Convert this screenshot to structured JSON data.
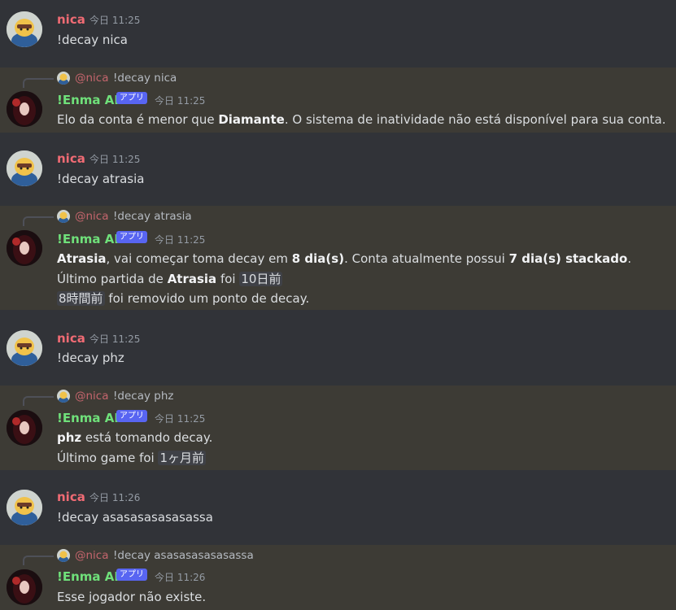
{
  "badge_label": "アプリ",
  "messages": [
    {
      "author": "nica",
      "time": "今日 11:25",
      "text": "!decay nica"
    },
    {
      "reply_mention": "@nica",
      "reply_text": "!decay nica",
      "author": "!Enma AI",
      "time": "今日 11:25",
      "line1_pre": "Elo da conta é menor que ",
      "line1_bold": "Diamante",
      "line1_post": ". O sistema de inatividade não está disponível para sua conta."
    },
    {
      "author": "nica",
      "time": "今日 11:25",
      "text": "!decay atrasia"
    },
    {
      "reply_mention": "@nica",
      "reply_text": "!decay atrasia",
      "author": "!Enma AI",
      "time": "今日 11:25",
      "l1_b1": "Atrasia",
      "l1_t1": ", vai começar toma decay em ",
      "l1_b2": "8 dia(s)",
      "l1_t2": ". Conta atualmente possui ",
      "l1_b3": "7 dia(s) stackado",
      "l1_t3": ".",
      "l2_t1": "Último partida de ",
      "l2_b1": "Atrasia",
      "l2_t2": " foi ",
      "l2_ts": "10日前",
      "l3_ts": "8時間前",
      "l3_t1": " foi removido um ponto de decay."
    },
    {
      "author": "nica",
      "time": "今日 11:25",
      "text": "!decay phz"
    },
    {
      "reply_mention": "@nica",
      "reply_text": "!decay phz",
      "author": "!Enma AI",
      "time": "今日 11:25",
      "l1_b1": "phz",
      "l1_t1": " está tomando decay.",
      "l2_t1": "Último game foi ",
      "l2_ts": "1ヶ月前"
    },
    {
      "author": "nica",
      "time": "今日 11:26",
      "text": "!decay asasasasasasassa"
    },
    {
      "reply_mention": "@nica",
      "reply_text": "!decay asasasasasasassa",
      "author": "!Enma AI",
      "time": "今日 11:26",
      "text": "Esse jogador não existe."
    }
  ]
}
